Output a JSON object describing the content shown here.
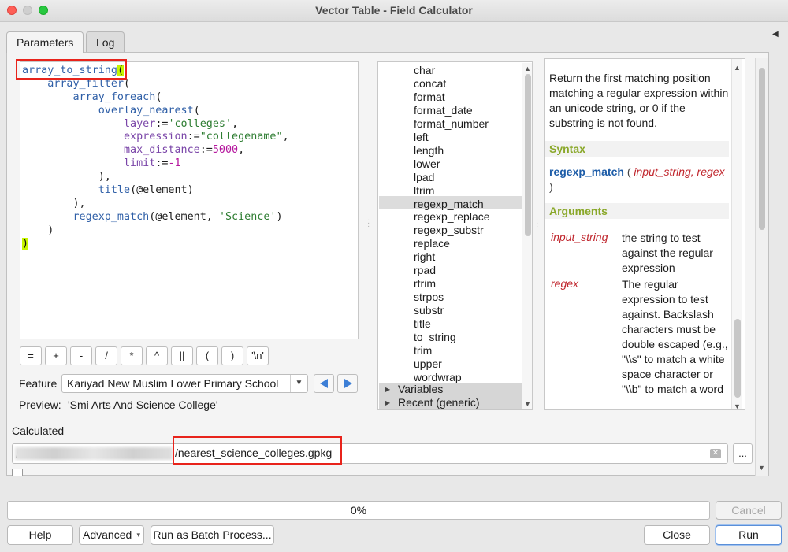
{
  "window": {
    "title": "Vector Table - Field Calculator"
  },
  "tabs": {
    "parameters": "Parameters",
    "log": "Log"
  },
  "expression": {
    "lines": [
      [
        [
          "fn",
          "array_to_string"
        ],
        [
          "hl",
          "("
        ]
      ],
      [
        [
          "t",
          "    "
        ],
        [
          "fn",
          "array_filter"
        ],
        [
          "t",
          "("
        ]
      ],
      [
        [
          "t",
          "        "
        ],
        [
          "fn",
          "array_foreach"
        ],
        [
          "t",
          "("
        ]
      ],
      [
        [
          "t",
          "            "
        ],
        [
          "fn",
          "overlay_nearest"
        ],
        [
          "t",
          "("
        ]
      ],
      [
        [
          "t",
          "                "
        ],
        [
          "kw",
          "layer"
        ],
        [
          "t",
          ":="
        ],
        [
          "str",
          "'colleges'"
        ],
        [
          "t",
          ","
        ]
      ],
      [
        [
          "t",
          "                "
        ],
        [
          "kw",
          "expression"
        ],
        [
          "t",
          ":="
        ],
        [
          "str",
          "\"collegename\""
        ],
        [
          "t",
          ","
        ]
      ],
      [
        [
          "t",
          "                "
        ],
        [
          "kw",
          "max_distance"
        ],
        [
          "t",
          ":="
        ],
        [
          "num",
          "5000"
        ],
        [
          "t",
          ","
        ]
      ],
      [
        [
          "t",
          "                "
        ],
        [
          "kw",
          "limit"
        ],
        [
          "t",
          ":="
        ],
        [
          "num",
          "-1"
        ]
      ],
      [
        [
          "t",
          "            ),"
        ]
      ],
      [
        [
          "t",
          "            "
        ],
        [
          "fn",
          "title"
        ],
        [
          "t",
          "(@element)"
        ]
      ],
      [
        [
          "t",
          "        ),"
        ]
      ],
      [
        [
          "t",
          "        "
        ],
        [
          "fn",
          "regexp_match"
        ],
        [
          "t",
          "(@element, "
        ],
        [
          "str",
          "'Science'"
        ],
        [
          "t",
          ")"
        ]
      ],
      [
        [
          "t",
          "    )"
        ]
      ],
      [
        [
          "hl",
          ")"
        ]
      ]
    ]
  },
  "operators": [
    "=",
    "+",
    "-",
    "/",
    "*",
    "^",
    "||",
    "(",
    ")",
    "'\\n'"
  ],
  "feature": {
    "label": "Feature",
    "value": "Kariyad New Muslim Lower Primary School"
  },
  "preview": {
    "label": "Preview:",
    "value": "'Smi Arts And Science College'"
  },
  "function_list": {
    "items": [
      "char",
      "concat",
      "format",
      "format_date",
      "format_number",
      "left",
      "length",
      "lower",
      "lpad",
      "ltrim",
      "regexp_match",
      "regexp_replace",
      "regexp_substr",
      "replace",
      "right",
      "rpad",
      "rtrim",
      "strpos",
      "substr",
      "title",
      "to_string",
      "trim",
      "upper",
      "wordwrap"
    ],
    "selected": "regexp_match",
    "groups": [
      "Variables",
      "Recent (generic)"
    ]
  },
  "help": {
    "description": "Return the first matching position matching a regular expression within an unicode string, or 0 if the substring is not found.",
    "syntax_heading": "Syntax",
    "syntax_fn": "regexp_match",
    "syntax_args": "input_string, regex",
    "arguments_heading": "Arguments",
    "arguments": [
      {
        "name": "input_string",
        "desc": "the string to test against the regular expression"
      },
      {
        "name": "regex",
        "desc": "The regular expression to test against. Backslash characters must be double escaped (e.g., \"\\\\s\" to match a white space character or \"\\\\b\" to match a word"
      }
    ]
  },
  "output": {
    "label": "Calculated",
    "prefix": "/",
    "file": "/nearest_science_colleges.gpkg",
    "browse": "..."
  },
  "progress": {
    "percent": 0,
    "text": "0%"
  },
  "buttons": {
    "cancel": "Cancel",
    "help": "Help",
    "advanced": "Advanced",
    "batch": "Run as Batch Process...",
    "close": "Close",
    "run": "Run"
  }
}
